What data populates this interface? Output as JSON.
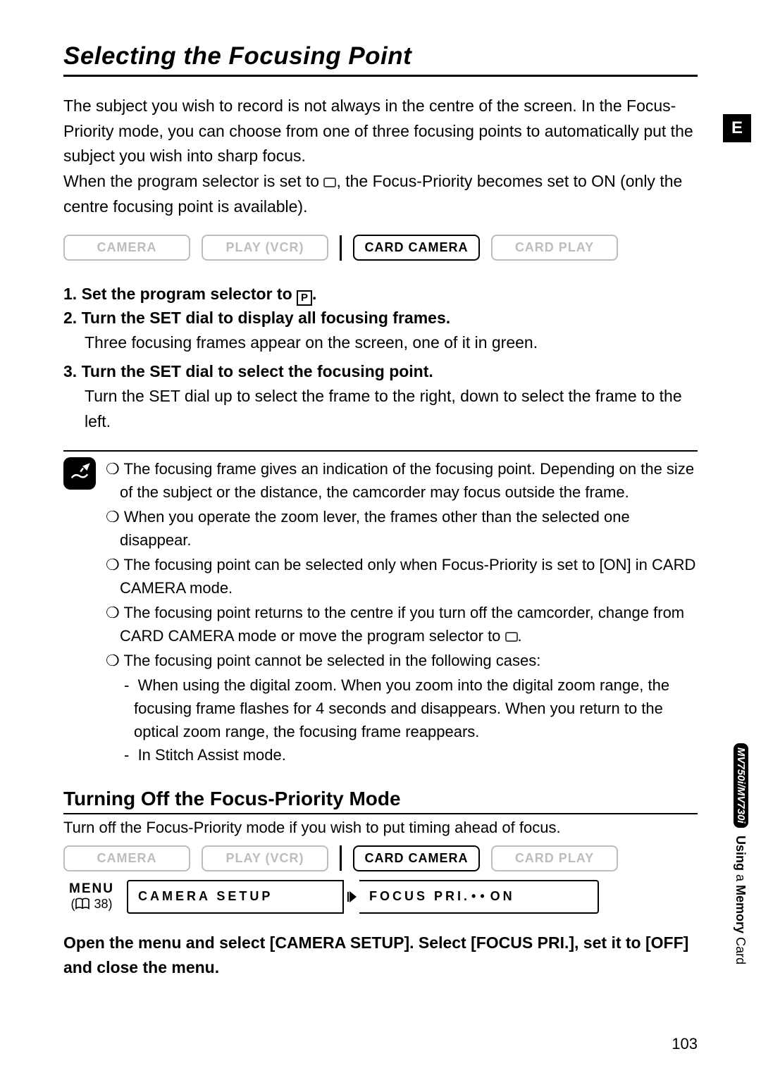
{
  "page_title": "Selecting the Focusing Point",
  "intro_p1": "The subject you wish to record is not always in the centre of the screen. In the Focus-Priority mode, you can choose from one of three focusing points to automatically put the subject you wish into sharp focus.",
  "intro_p2a": "When the program selector is set to ",
  "intro_p2b": ", the Focus-Priority becomes set to ON (only the centre focusing point is available).",
  "modes": {
    "camera": "CAMERA",
    "play": "PLAY (VCR)",
    "card_camera": "CARD CAMERA",
    "card_play": "CARD PLAY"
  },
  "steps": {
    "s1a": "1. Set the program selector to ",
    "s1b": ".",
    "s2": "2. Turn the SET dial to display all focusing frames.",
    "s2_body": "Three focusing frames appear on the screen, one of it in green.",
    "s3": "3. Turn the SET dial to select the focusing point.",
    "s3_body": "Turn the SET dial up to select the frame to the right, down to select the frame to the left."
  },
  "notes": {
    "n1": "The focusing frame gives an indication of the focusing point. Depending on the size of the subject or the distance, the camcorder may focus outside the frame.",
    "n2": "When you operate the zoom lever, the frames other than the selected one disappear.",
    "n3": "The focusing point can be selected only when Focus-Priority is set to [ON] in CARD CAMERA mode.",
    "n4a": "The focusing point returns to the centre if you turn off the camcorder, change from CARD CAMERA mode or move the program selector to ",
    "n4b": ".",
    "n5": "The focusing point cannot be selected in the following cases:",
    "n5a": "When using the digital zoom. When you zoom into the digital zoom range, the focusing frame flashes for 4 seconds and disappears. When you return to the optical zoom range, the focusing frame reappears.",
    "n5b": "In Stitch Assist mode."
  },
  "subhead": "Turning Off the Focus-Priority Mode",
  "sub_intro": "Turn off the Focus-Priority mode if you wish to put timing ahead of focus.",
  "menu_area": {
    "menu_label": "MENU",
    "menu_ref": "38",
    "camera_setup": "CAMERA SETUP",
    "focus_pri": "FOCUS PRI.",
    "focus_value": "ON"
  },
  "final_instruction": "Open the menu and select [CAMERA SETUP]. Select [FOCUS PRI.], set it to [OFF] and close the menu.",
  "side": {
    "e_tab": "E",
    "model": "MV750i/MV730i",
    "section": "Using",
    "section_mid": " a ",
    "section_bold": "Memory",
    "section_end": " Card"
  },
  "page_number": "103"
}
